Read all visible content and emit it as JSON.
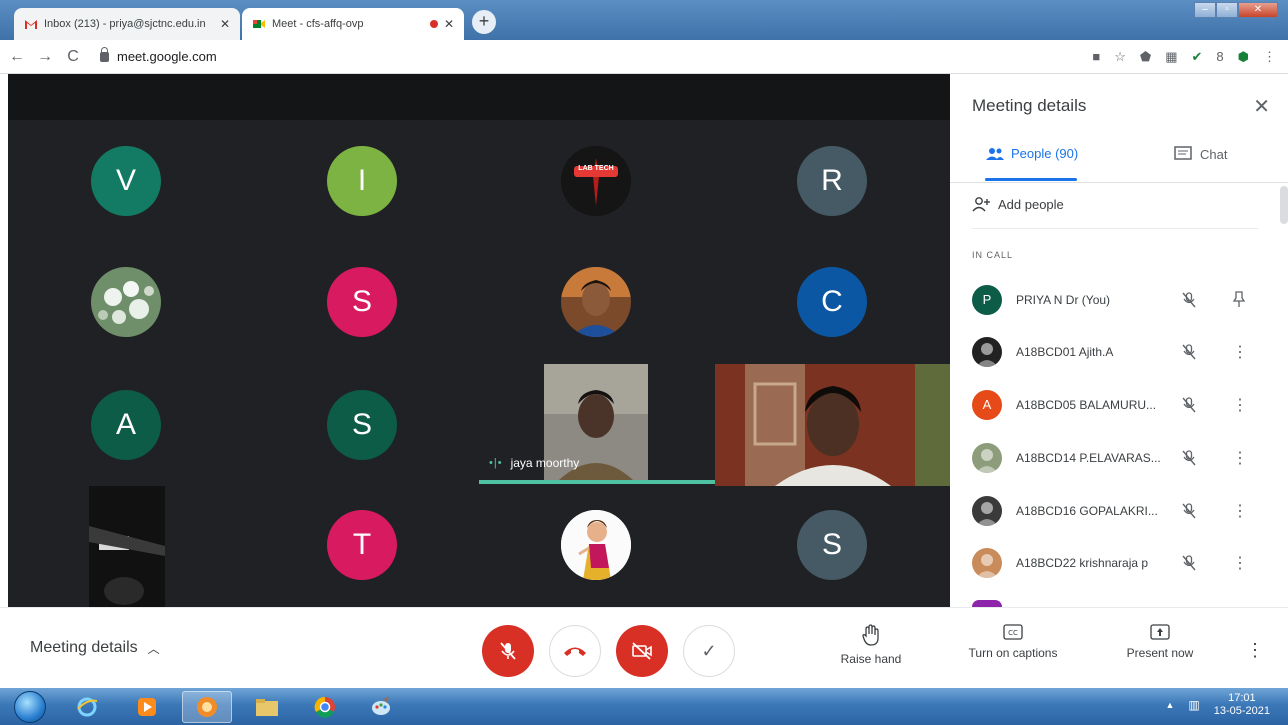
{
  "browser": {
    "tabs": [
      {
        "label": "Inbox (213) - priya@sjctnc.edu.in",
        "icon": "gmail-icon"
      },
      {
        "label": "Meet - cfs-affq-ovp",
        "icon": "meet-icon"
      }
    ],
    "url": "meet.google.com"
  },
  "stage": {
    "tiles": [
      {
        "kind": "letter",
        "letter": "V",
        "color": "#137a63"
      },
      {
        "kind": "letter",
        "letter": "I",
        "color": "#7cb342"
      },
      {
        "kind": "logo",
        "text": "LAB TECH"
      },
      {
        "kind": "letter",
        "letter": "R",
        "color": "#455a64"
      },
      {
        "kind": "photo",
        "theme": "flowers"
      },
      {
        "kind": "letter",
        "letter": "S",
        "color": "#d81b60"
      },
      {
        "kind": "photo",
        "theme": "person"
      },
      {
        "kind": "letter",
        "letter": "C",
        "color": "#0b57a3"
      },
      {
        "kind": "letter",
        "letter": "A",
        "color": "#0d5c48"
      },
      {
        "kind": "letter",
        "letter": "S",
        "color": "#0d5c48"
      },
      {
        "kind": "letter",
        "letter": "T",
        "color": "#d81b60"
      },
      {
        "kind": "photo",
        "theme": "cartoon"
      },
      {
        "kind": "letter",
        "letter": "S",
        "color": "#455a64"
      }
    ],
    "active_speaker": "jaya moorthy"
  },
  "panel": {
    "title": "Meeting details",
    "people_tab": "People (90)",
    "chat_tab": "Chat",
    "add_people": "Add people",
    "section_label": "IN CALL",
    "participants": [
      {
        "name": "PRIYA N Dr (You)",
        "initial": "P",
        "color": "#0d5c48",
        "action": "pin-icon"
      },
      {
        "name": "A18BCD01 Ajith.A",
        "initial": "",
        "color": "#222222",
        "action": "more-icon"
      },
      {
        "name": "A18BCD05 BALAMURU...",
        "initial": "A",
        "color": "#e64a19",
        "action": "more-icon"
      },
      {
        "name": "A18BCD14 P.ELAVARAS...",
        "initial": "",
        "color": "#8d9c7a",
        "action": "more-icon"
      },
      {
        "name": "A18BCD16 GOPALAKRI...",
        "initial": "",
        "color": "#3a3a3a",
        "action": "more-icon"
      },
      {
        "name": "A18BCD22 krishnaraja p",
        "initial": "",
        "color": "#c98b5a",
        "action": "more-icon"
      }
    ]
  },
  "controls": {
    "meeting_details": "Meeting details",
    "raise_hand": "Raise hand",
    "captions": "Turn on captions",
    "present": "Present now"
  },
  "taskbar": {
    "time": "17:01",
    "date": "13-05-2021"
  }
}
